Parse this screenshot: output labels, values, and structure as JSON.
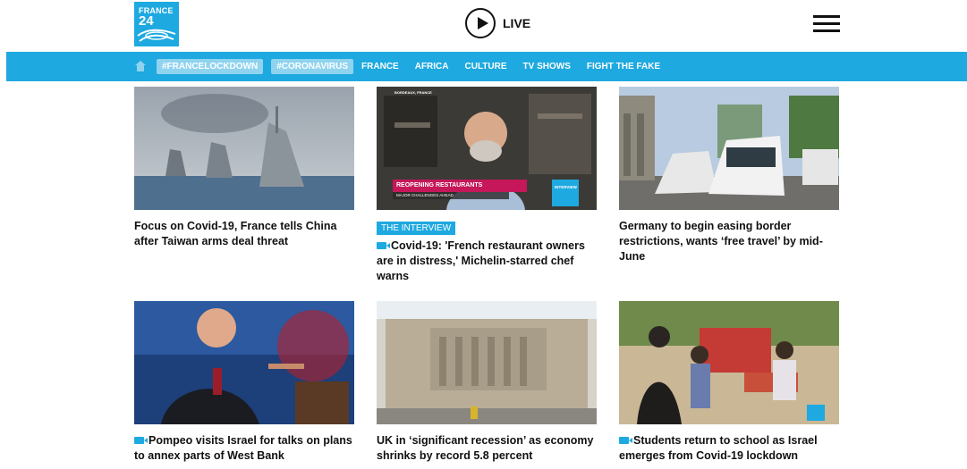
{
  "header": {
    "logo_line1": "FRANCE",
    "logo_line2": "24",
    "live_label": "LIVE"
  },
  "nav": {
    "tags": [
      "#FRANCELOCKDOWN",
      "#CORONAVIRUS"
    ],
    "links": [
      "FRANCE",
      "AFRICA",
      "CULTURE",
      "TV SHOWS",
      "FIGHT THE FAKE"
    ]
  },
  "articles": [
    {
      "title": "Focus on Covid-19, France tells China after Taiwan arms deal threat",
      "badge": "",
      "video": false
    },
    {
      "title": "Covid-19: 'French restaurant owners are in distress,' Michelin-starred chef warns",
      "badge": "THE INTERVIEW",
      "video": true,
      "thumb_overlay": "REOPENING RESTAURANTS",
      "thumb_sub": "MAJOR CHALLENGES AHEAD",
      "thumb_corner": "INTERVIEW",
      "thumb_location": "BORDEAUX, FRANCE"
    },
    {
      "title": "Germany to begin easing border restrictions, wants ‘free travel’ by mid-June",
      "badge": "",
      "video": false
    },
    {
      "title": "Pompeo visits Israel for talks on plans to annex parts of West Bank",
      "badge": "",
      "video": true
    },
    {
      "title": "UK in ‘significant recession’ as economy shrinks by record 5.8 percent",
      "badge": "",
      "video": false
    },
    {
      "title": "Students return to school as Israel emerges from Covid-19 lockdown",
      "badge": "",
      "video": true
    }
  ],
  "colors": {
    "brand": "#1ea9e0",
    "tag_bg": "#8fd3ef"
  }
}
